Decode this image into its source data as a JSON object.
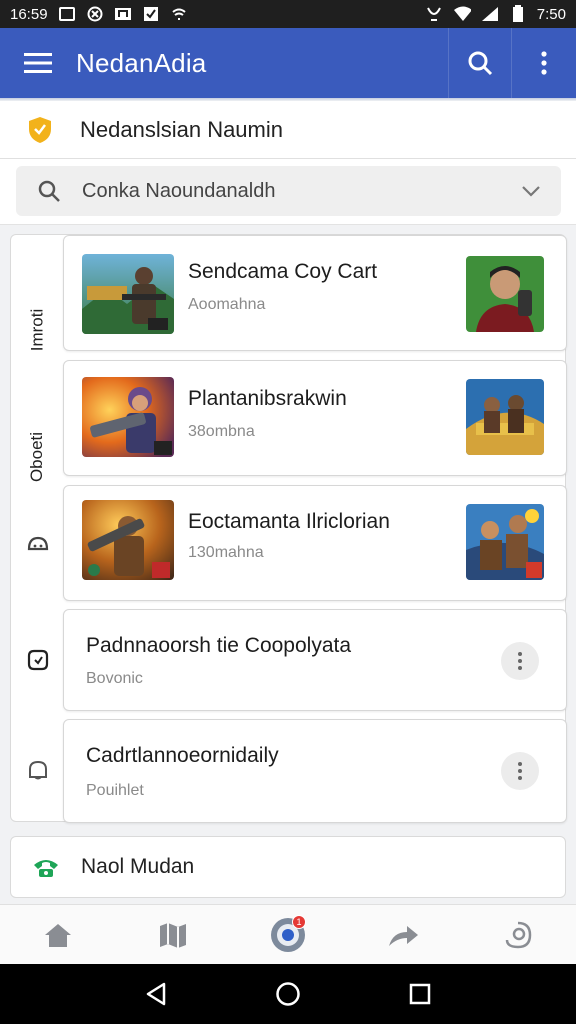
{
  "status_bar": {
    "time_left": "16:59",
    "time_right": "7:50",
    "icons_left": [
      "image-icon",
      "circle-x-icon",
      "music-icon",
      "check-square-icon",
      "wifi-small-icon"
    ],
    "icons_right": [
      "vibrate-icon",
      "wifi-icon",
      "signal-icon",
      "battery-icon"
    ]
  },
  "app_bar": {
    "title": "NedanAdia",
    "menu_icon": "hamburger-icon",
    "search_icon": "search-icon",
    "more_icon": "more-vert-icon"
  },
  "section_header": {
    "icon": "shield-icon",
    "title": "Nedanslsian Naumin"
  },
  "search": {
    "value": "Conka Naoundanaldh",
    "search_icon": "search-icon",
    "dropdown_icon": "chevron-down-icon"
  },
  "side_rail": {
    "labels": [
      "Imroti",
      "Oboeti"
    ],
    "icons": [
      "reaction-icon",
      "calendar-icon",
      "notification-icon"
    ]
  },
  "cards": [
    {
      "title": "Sendcama Coy Cart",
      "subtitle": "Aoomahna",
      "has_thumb": true,
      "has_right_thumb": true
    },
    {
      "title": "Plantanibsrakwin",
      "subtitle": "38ombna",
      "has_thumb": true,
      "has_right_thumb": true
    },
    {
      "title": "Eoctamanta Ilriclorian",
      "subtitle": "130mahna",
      "has_thumb": true,
      "has_right_thumb": true
    },
    {
      "title": "Padnnaoorsh tie Coopolyata",
      "subtitle": "Bovonic",
      "has_thumb": false,
      "has_right_thumb": false
    },
    {
      "title": "Cadrtlannoeornidaily",
      "subtitle": "Pouihlet",
      "has_thumb": false,
      "has_right_thumb": false
    }
  ],
  "footer_row": {
    "icon": "phone-icon",
    "text": "Naol Mudan"
  },
  "bottom_nav": {
    "items": [
      "home-icon",
      "map-icon",
      "browser-icon",
      "share-icon",
      "profile-icon"
    ],
    "badge": "1"
  },
  "colors": {
    "app_bar": "#3a5bbd",
    "accent_yellow": "#f2b21b",
    "accent_green": "#1ea557",
    "badge_red": "#e53935"
  }
}
